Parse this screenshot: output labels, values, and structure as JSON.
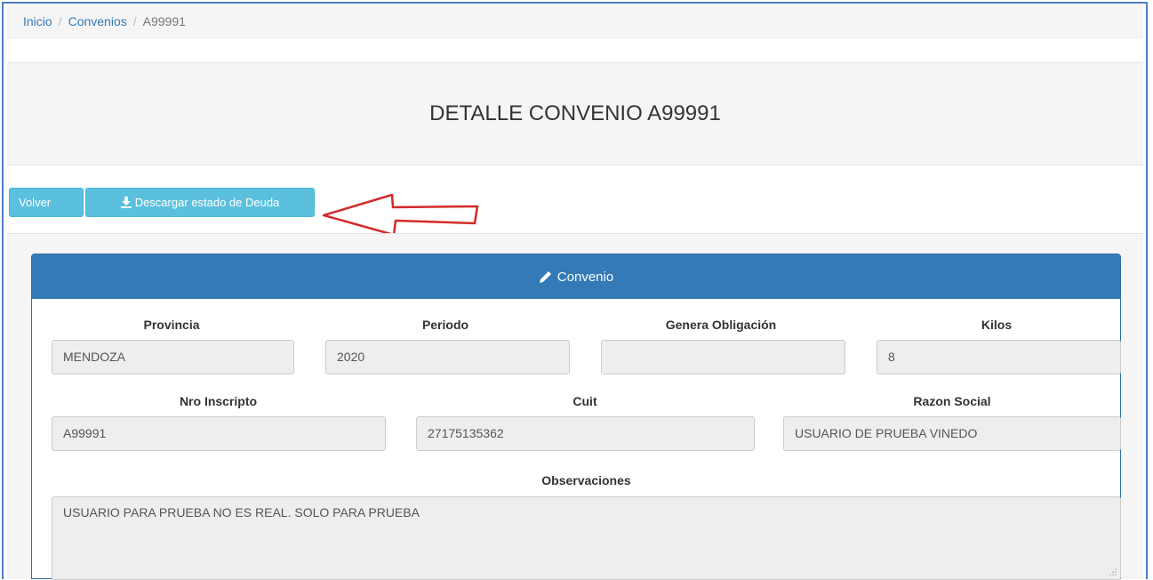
{
  "breadcrumb": {
    "items": [
      "Inicio",
      "Convenios"
    ],
    "current": "A99991"
  },
  "page_title": "DETALLE CONVENIO A99991",
  "actions": {
    "volver_label": "Volver",
    "descargar_label": "Descargar estado de Deuda"
  },
  "panel": {
    "title": "Convenio",
    "row1": [
      {
        "label": "Provincia",
        "value": "MENDOZA"
      },
      {
        "label": "Periodo",
        "value": "2020"
      },
      {
        "label": "Genera Obligación",
        "value": ""
      },
      {
        "label": "Kilos",
        "value": "8"
      }
    ],
    "row2": [
      {
        "label": "Nro Inscripto",
        "value": "A99991"
      },
      {
        "label": "Cuit",
        "value": "27175135362"
      },
      {
        "label": "Razon Social",
        "value": "USUARIO DE PRUEBA VINEDO"
      }
    ],
    "observaciones": {
      "label": "Observaciones",
      "value": "USUARIO PARA PRUEBA NO ES REAL. SOLO PARA PRUEBA"
    }
  },
  "colors": {
    "primary": "#337ab7",
    "info_button": "#5bc0de",
    "annotation_arrow": "#d42a2a",
    "frame": "#4a7fc7"
  },
  "icons": {
    "download": "download-icon",
    "pencil": "pencil-icon",
    "annotation": "red-arrow-annotation"
  }
}
